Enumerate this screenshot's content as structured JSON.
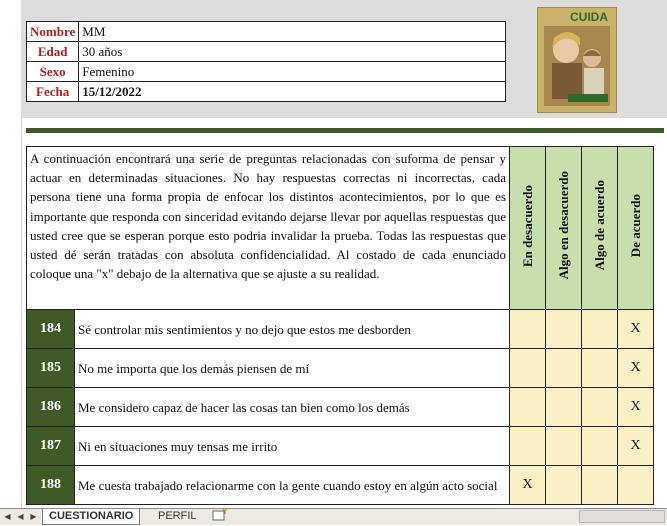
{
  "info": {
    "rows": [
      {
        "label": "Nombre",
        "value": "MM"
      },
      {
        "label": "Edad",
        "value": "30 años"
      },
      {
        "label": "Sexo",
        "value": "Femenino"
      },
      {
        "label": "Fecha",
        "value": "15/12/2022"
      }
    ]
  },
  "cover": {
    "title": "CUIDA"
  },
  "intro": "A continuación encontrará una serie de preguntas relacionadas con suforma de pensar y actuar en determinadas situaciones. No hay respuestas correctas ni incorrectas, cada persona tiene una forma propia de enfocar los distintos acontecimientos, por lo que es importante que responda con sinceridad evitando dejarse llevar por aquellas respuestas que usted cree que se esperan porque esto podria invalidar la prueba. Todas las respuestas que usted dé serán tratadas con absoluta confidencialidad. Al costado de cada enunciado coloque una \"x\" debajo de la alternativa que se ajuste a su realidad.",
  "options": [
    "En desacuerdo",
    "Algo en desacuerdo",
    "Algo de acuerdo",
    "De acuerdo"
  ],
  "questions": [
    {
      "num": "184",
      "text": "Sé controlar mis sentimientos y no dejo que estos me desborden",
      "answers": [
        "",
        "",
        "",
        "X"
      ]
    },
    {
      "num": "185",
      "text": "No me importa que los demás piensen de mí",
      "answers": [
        "",
        "",
        "",
        "X"
      ]
    },
    {
      "num": "186",
      "text": "Me considero capaz de hacer las cosas tan bien como los demás",
      "answers": [
        "",
        "",
        "",
        "X"
      ]
    },
    {
      "num": "187",
      "text": "Ni en situaciones muy tensas me irrito",
      "answers": [
        "",
        "",
        "",
        "X"
      ]
    },
    {
      "num": "188",
      "text": "Me cuesta trabajado relacionarme con la gente cuando estoy en algún acto social",
      "answers": [
        "X",
        "",
        "",
        ""
      ]
    }
  ],
  "tabs": {
    "active": "CUESTIONARIO",
    "second": "PERFIL"
  },
  "colors": {
    "dark_green": "#3f5a26",
    "light_green": "#c6dfad",
    "answer_bg": "#fbefc6",
    "label_red": "#b02020"
  }
}
